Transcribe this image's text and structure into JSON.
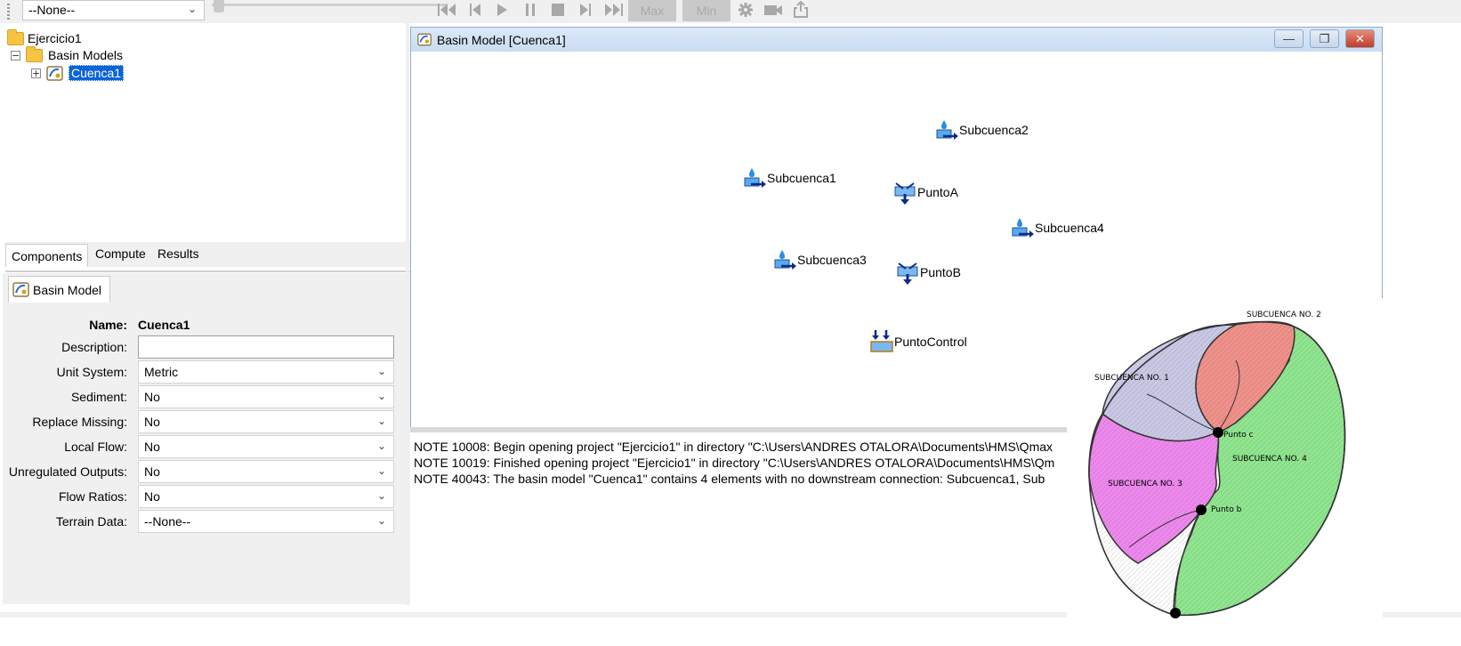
{
  "toolbar": {
    "run_selector_value": "--None--",
    "max_label": "Max",
    "min_label": "Min",
    "icons": [
      "skip-back-icon",
      "step-back-icon",
      "play-icon",
      "pause-icon",
      "stop-icon",
      "step-forward-icon",
      "skip-forward-icon",
      "gear-icon",
      "camera-icon",
      "export-icon"
    ]
  },
  "tree": {
    "project": "Ejercicio1",
    "folder": "Basin Models",
    "model": "Cuenca1"
  },
  "left_tabs": {
    "components": "Components",
    "compute": "Compute",
    "results": "Results"
  },
  "properties": {
    "tab_title": "Basin Model",
    "name_label": "Name:",
    "name_value": "Cuenca1",
    "description_label": "Description:",
    "description_value": "",
    "fields": [
      {
        "label": "Unit System:",
        "value": "Metric"
      },
      {
        "label": "Sediment:",
        "value": "No"
      },
      {
        "label": "Replace Missing:",
        "value": "No"
      },
      {
        "label": "Local Flow:",
        "value": "No"
      },
      {
        "label": "Unregulated Outputs:",
        "value": "No"
      },
      {
        "label": "Flow Ratios:",
        "value": "No"
      },
      {
        "label": "Terrain Data:",
        "value": "--None--"
      }
    ]
  },
  "basin_window": {
    "title": "Basin Model [Cuenca1]",
    "elements": [
      {
        "name": "Subcuenca2",
        "type": "subbasin"
      },
      {
        "name": "Subcuenca1",
        "type": "subbasin"
      },
      {
        "name": "PuntoA",
        "type": "junction"
      },
      {
        "name": "Subcuenca4",
        "type": "subbasin"
      },
      {
        "name": "Subcuenca3",
        "type": "subbasin"
      },
      {
        "name": "PuntoB",
        "type": "junction"
      },
      {
        "name": "PuntoControl",
        "type": "sink"
      }
    ]
  },
  "log": [
    "NOTE 10008:  Begin opening project \"Ejercicio1\" in directory \"C:\\Users\\ANDRES OTALORA\\Documents\\HMS\\Qmax",
    "NOTE 10019:  Finished opening project \"Ejercicio1\" in directory \"C:\\Users\\ANDRES OTALORA\\Documents\\HMS\\Qm",
    "NOTE 40043:  The basin model \"Cuenca1\" contains 4 elements with no downstream connection: Subcuenca1, Sub"
  ],
  "map": {
    "labels": {
      "sub1": "SUBCUENCA NO. 1",
      "sub2": "SUBCUENCA NO. 2",
      "sub3": "SUBCUENCA NO. 3",
      "sub4": "SUBCUENCA NO. 4",
      "punto_c": "Punto c",
      "punto_b": "Punto b"
    },
    "colors": {
      "sub1": "#c9c9e6",
      "sub2": "#f0918a",
      "sub3": "#ee88ee",
      "sub4": "#8fe68f"
    }
  }
}
